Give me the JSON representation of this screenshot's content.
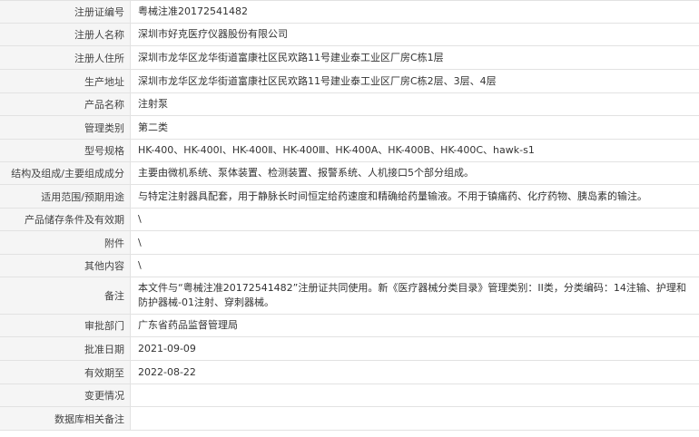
{
  "record": {
    "rows": [
      {
        "label": "注册证编号",
        "value": "粤械注准20172541482"
      },
      {
        "label": "注册人名称",
        "value": "深圳市好克医疗仪器股份有限公司"
      },
      {
        "label": "注册人住所",
        "value": "深圳市龙华区龙华街道富康社区民欢路11号建业泰工业区厂房C栋1层"
      },
      {
        "label": "生产地址",
        "value": "深圳市龙华区龙华街道富康社区民欢路11号建业泰工业区厂房C栋2层、3层、4层"
      },
      {
        "label": "产品名称",
        "value": "注射泵"
      },
      {
        "label": "管理类别",
        "value": "第二类"
      },
      {
        "label": "型号规格",
        "value": "HK-400、HK-400Ⅰ、HK-400Ⅱ、HK-400Ⅲ、HK-400A、HK-400B、HK-400C、hawk-s1"
      },
      {
        "label": "结构及组成/主要组成成分",
        "value": "主要由微机系统、泵体装置、检测装置、报警系统、人机接口5个部分组成。"
      },
      {
        "label": "适用范围/预期用途",
        "value": "与特定注射器具配套，用于静脉长时间恒定给药速度和精确给药量输液。不用于镇痛药、化疗药物、胰岛素的输注。"
      },
      {
        "label": "产品储存条件及有效期",
        "value": "\\"
      },
      {
        "label": "附件",
        "value": "\\"
      },
      {
        "label": "其他内容",
        "value": "\\"
      },
      {
        "label": "备注",
        "value": "本文件与“粤械注准20172541482”注册证共同使用。新《医疗器械分类目录》管理类别：II类，分类编码：14注输、护理和防护器械-01注射、穿刺器械。"
      },
      {
        "label": "审批部门",
        "value": "广东省药品监督管理局"
      },
      {
        "label": "批准日期",
        "value": "2021-09-09"
      },
      {
        "label": "有效期至",
        "value": "2022-08-22"
      },
      {
        "label": "变更情况",
        "value": ""
      },
      {
        "label": "数据库相关备注",
        "value": ""
      }
    ]
  }
}
